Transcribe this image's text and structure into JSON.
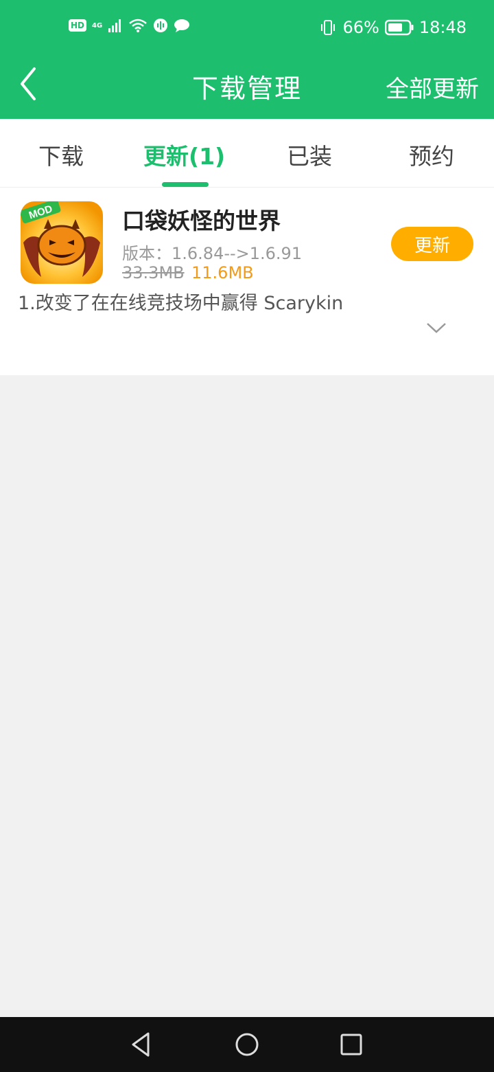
{
  "status_bar": {
    "hd": "HD",
    "network": "4G",
    "battery_percent": "66%",
    "time": "18:48"
  },
  "header": {
    "title": "下载管理",
    "update_all": "全部更新"
  },
  "tabs": [
    {
      "label": "下载"
    },
    {
      "label": "更新(1)",
      "active": true
    },
    {
      "label": "已装"
    },
    {
      "label": "预约"
    }
  ],
  "app_item": {
    "name": "口袋妖怪的世界",
    "icon_badge": "MOD",
    "version": "版本：1.6.84-->1.6.91",
    "old_size": "33.3MB",
    "new_size": "11.6MB",
    "update_button": "更新",
    "changelog": "1.改变了在在线竞技场中赢得 Scarykin"
  },
  "colors": {
    "brand_green": "#1dbe6e",
    "update_orange": "#ffae00",
    "size_orange": "#f29a1a",
    "background": "#f1f1f1"
  },
  "icons": [
    "back-icon",
    "chevron-down-icon",
    "signal-icon",
    "wifi-icon",
    "battery-icon",
    "nav-back-icon",
    "nav-home-icon",
    "nav-recent-icon"
  ]
}
